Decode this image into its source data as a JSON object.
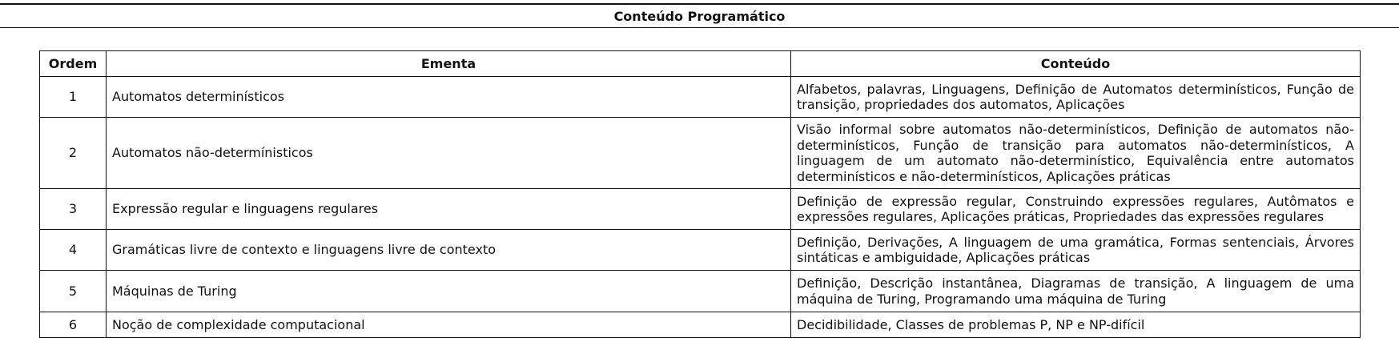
{
  "section": {
    "title": "Conteúdo Programático"
  },
  "table": {
    "headers": {
      "ordem": "Ordem",
      "ementa": "Ementa",
      "conteudo": "Conteúdo"
    },
    "rows": [
      {
        "ordem": "1",
        "ementa": "Automatos determinísticos",
        "conteudo": "Alfabetos, palavras, Linguagens, Definição de Automatos determinísticos, Função de transição, propriedades dos automatos, Aplicações"
      },
      {
        "ordem": "2",
        "ementa": "Automatos não-determínisticos",
        "conteudo": "Visão informal sobre automatos não-determinísticos, Definição de automatos não-determinísticos, Função de transição para automatos não-determinísticos, A linguagem de um automato não-determinístico, Equivalência entre automatos determinísticos e não-determinísticos, Aplicações práticas"
      },
      {
        "ordem": "3",
        "ementa": "Expressão regular e linguagens regulares",
        "conteudo": "Definição de expressão regular, Construindo expressões regulares, Autômatos e expressões regulares, Aplicações práticas, Propriedades das expressões regulares"
      },
      {
        "ordem": "4",
        "ementa": "Gramáticas livre de contexto e linguagens livre de contexto",
        "conteudo": "Definição, Derivações, A linguagem de uma gramática, Formas sentenciais, Árvores sintáticas e ambiguidade, Aplicações práticas"
      },
      {
        "ordem": "5",
        "ementa": "Máquinas de Turing",
        "conteudo": "Definição, Descrição instantânea, Diagramas de transição, A linguagem de uma máquina de Turing, Programando uma máquina de Turing"
      },
      {
        "ordem": "6",
        "ementa": "Noção de complexidade computacional",
        "conteudo": "Decidibilidade, Classes de problemas P, NP e NP-difícil"
      }
    ]
  }
}
